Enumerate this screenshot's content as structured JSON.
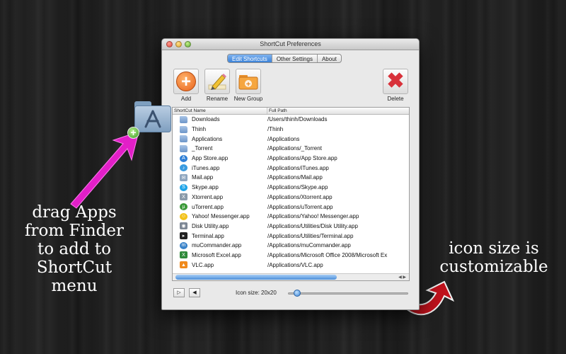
{
  "window": {
    "title": "ShortCut Preferences",
    "tabs": [
      {
        "label": "Edit Shortcuts",
        "active": true
      },
      {
        "label": "Other Settings",
        "active": false
      },
      {
        "label": "About",
        "active": false
      }
    ]
  },
  "toolbar": {
    "add_label": "Add",
    "rename_label": "Rename",
    "new_group_label": "New Group",
    "delete_label": "Delete"
  },
  "table": {
    "headers": {
      "name": "ShortCut Name",
      "path": "Full Path"
    },
    "rows": [
      {
        "name": "Downloads",
        "path": "/Users/thinh/Downloads",
        "icon": "folder-icon"
      },
      {
        "name": "Thinh",
        "path": "/Thinh",
        "icon": "folder-icon"
      },
      {
        "name": "Applications",
        "path": "/Applications",
        "icon": "folder-icon"
      },
      {
        "name": "_Torrent",
        "path": "/Applications/_Torrent",
        "icon": "folder-icon"
      },
      {
        "name": "App Store.app",
        "path": "/Applications/App Store.app",
        "icon": "app-store-icon"
      },
      {
        "name": "iTunes.app",
        "path": "/Applications/iTunes.app",
        "icon": "itunes-icon"
      },
      {
        "name": "Mail.app",
        "path": "/Applications/Mail.app",
        "icon": "mail-icon"
      },
      {
        "name": "Skype.app",
        "path": "/Applications/Skype.app",
        "icon": "skype-icon"
      },
      {
        "name": "Xtorrent.app",
        "path": "/Applications/Xtorrent.app",
        "icon": "xtorrent-icon"
      },
      {
        "name": "uTorrent.app",
        "path": "/Applications/uTorrent.app",
        "icon": "utorrent-icon"
      },
      {
        "name": "Yahoo! Messenger.app",
        "path": "/Applications/Yahoo! Messenger.app",
        "icon": "yahoo-messenger-icon"
      },
      {
        "name": "Disk Utility.app",
        "path": "/Applications/Utilities/Disk Utility.app",
        "icon": "disk-utility-icon"
      },
      {
        "name": "Terminal.app",
        "path": "/Applications/Utilities/Terminal.app",
        "icon": "terminal-icon"
      },
      {
        "name": "muCommander.app",
        "path": "/Applications/muCommander.app",
        "icon": "mucommander-icon"
      },
      {
        "name": "Microsoft Excel.app",
        "path": "/Applications/Microsoft Office 2008/Microsoft Ex",
        "icon": "excel-icon"
      },
      {
        "name": "VLC.app",
        "path": "/Applications/VLC.app",
        "icon": "vlc-icon"
      }
    ]
  },
  "bottom": {
    "icon_size_label": "Icon size: 20x20"
  },
  "captions": {
    "left": [
      "drag Apps",
      "from Finder",
      "to add to",
      "ShortCut",
      "menu"
    ],
    "right": [
      "icon size is",
      "customizable"
    ]
  },
  "colors": {
    "accent_blue": "#3b82d8",
    "arrow_magenta": "#e21fc8",
    "arrow_red": "#c0121c"
  }
}
